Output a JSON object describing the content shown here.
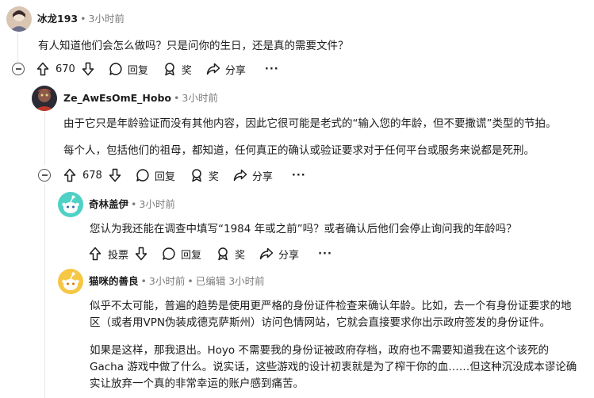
{
  "comments": [
    {
      "author": "冰龙193",
      "time": "3小时前",
      "body": [
        "有人知道他们会怎么做吗？只是问你的生日，还是真的需要文件？"
      ],
      "votes": "670",
      "reply": "回复",
      "award": "奖",
      "share": "分享",
      "more": "···"
    },
    {
      "author": "Ze_AwEsOmE_Hobo",
      "time": "3小时前",
      "body": [
        "由于它只是年龄验证而没有其他内容，因此它很可能是老式的“输入您的年龄，但不要撒谎”类型的节拍。",
        "每个人，包括他们的祖母，都知道，任何真正的确认或验证要求对于任何平台或服务来说都是死刑。"
      ],
      "votes": "678",
      "reply": "回复",
      "award": "奖",
      "share": "分享",
      "more": "···"
    },
    {
      "author": "奇林盖伊",
      "time": "3小时前",
      "body": [
        "您认为我还能在调查中填写“1984 年或之前”吗？或者确认后他们会停止询问我的年龄吗？"
      ],
      "votes": "投票",
      "reply": "回复",
      "award": "奖",
      "share": "分享",
      "more": "···"
    },
    {
      "author": "猫咪的善良",
      "time": "3小时前",
      "edited": "已编辑 3小时前",
      "body": [
        "似乎不太可能，普遍的趋势是使用更严格的身份证件检查来确认年龄。比如，去一个有身份证要求的地区（或者用VPN伪装成德克萨斯州）访问色情网站，它就会直接要求你出示政府签发的身份证件。",
        "如果是这样，那我退出。Hoyo 不需要我的身份证被政府存档，政府也不需要知道我在这个该死的 Gacha 游戏中做了什么。说实话，这些游戏的设计初衷就是为了榨干你的血……但这种沉没成本谬论确实让放弃一个真的非常幸运的账户感到痛苦。"
      ]
    }
  ],
  "colors": {
    "time": "#7c7c7c",
    "line": "#e5e5e5",
    "text": "#1c1c1c"
  }
}
